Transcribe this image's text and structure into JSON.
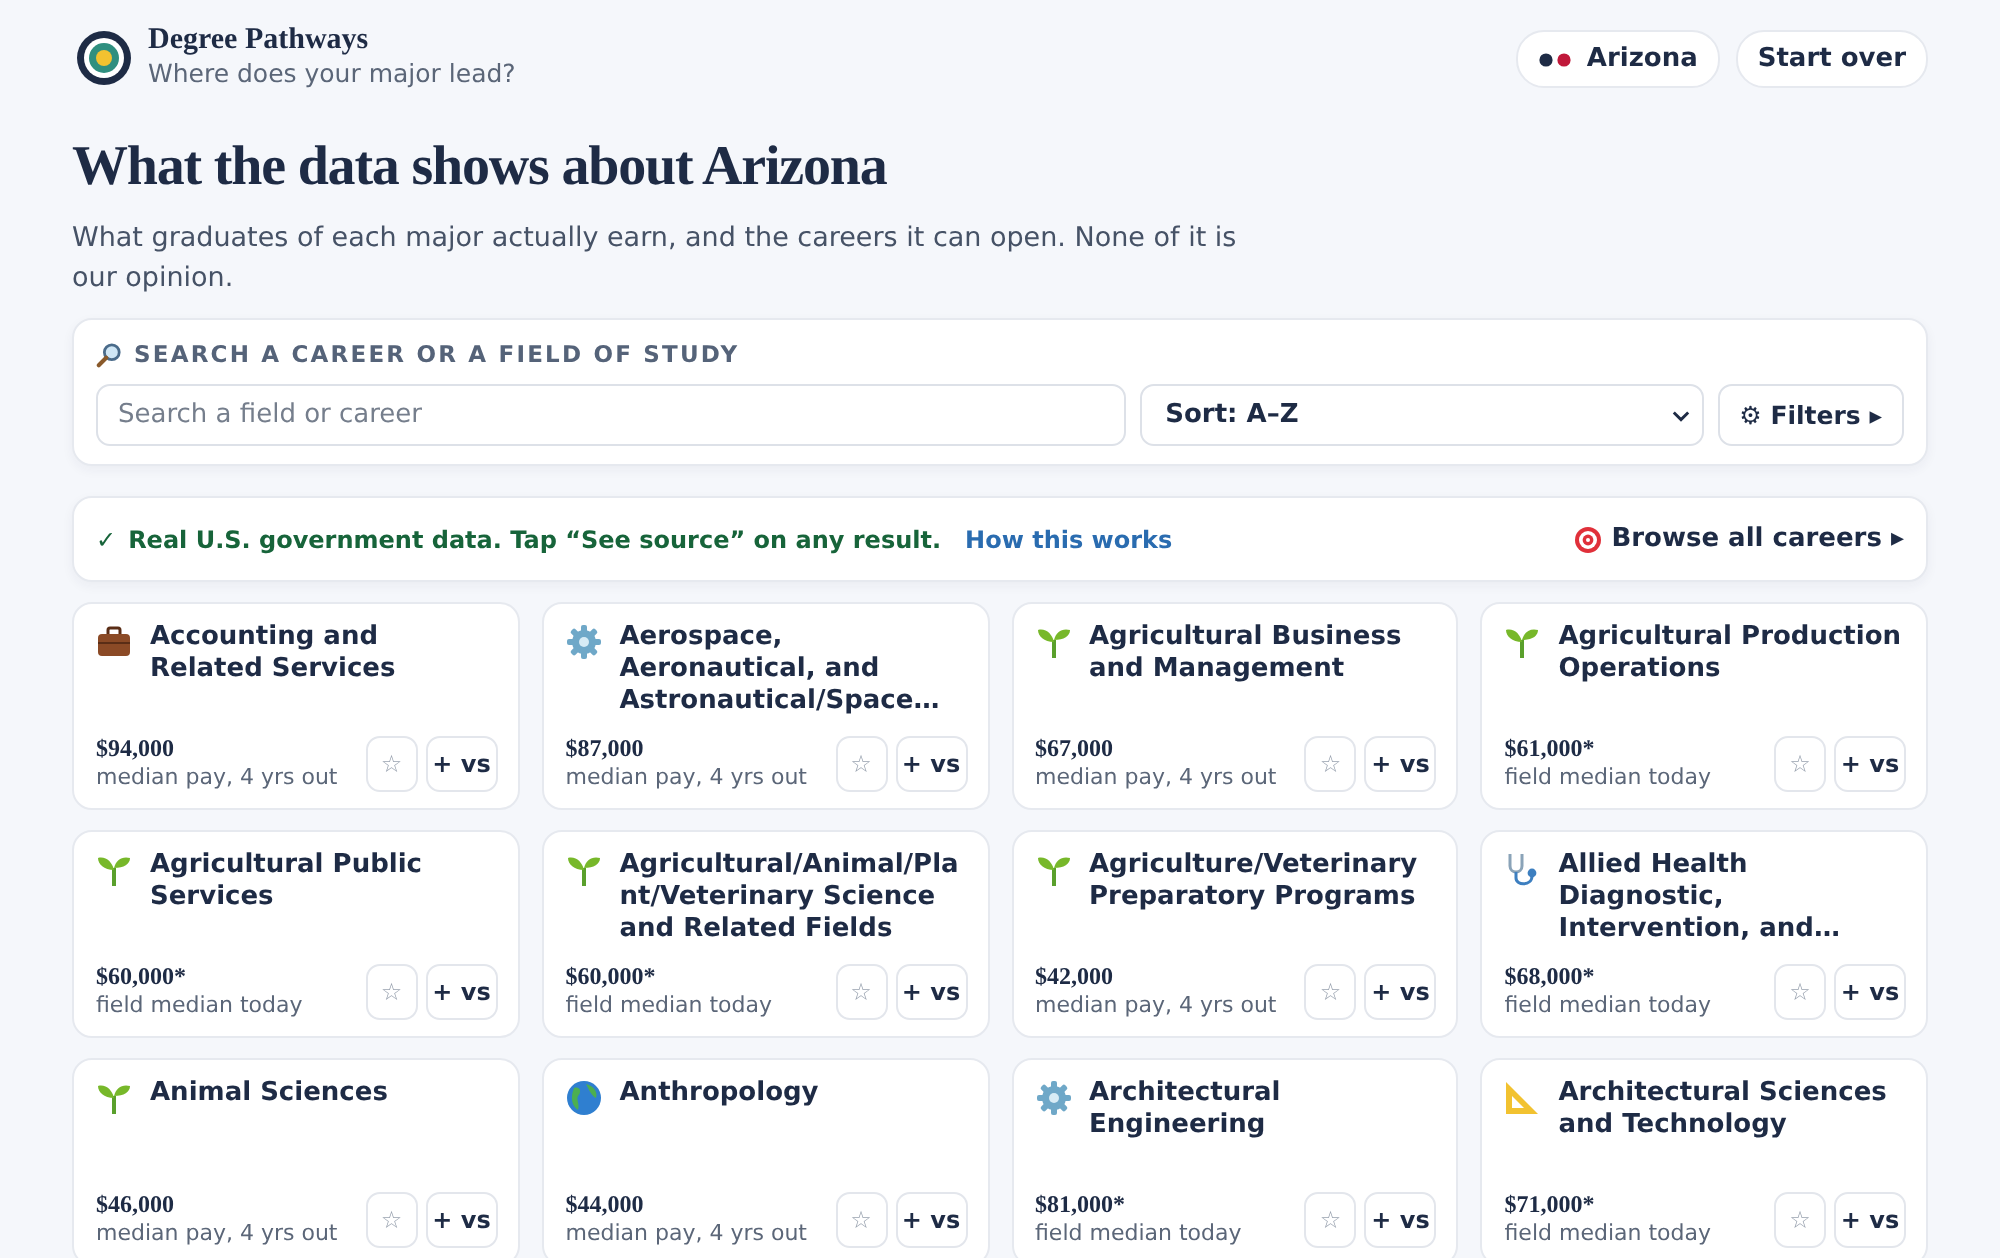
{
  "brand": {
    "name": "Degree Pathways",
    "tagline": "Where does your major lead?"
  },
  "header_actions": {
    "state": "Arizona",
    "start_over": "Start over"
  },
  "heading": "What the data shows about Arizona",
  "intro": "What graduates of each major actually earn, and the careers it can open. None of it is our opinion.",
  "search": {
    "label": "SEARCH A CAREER OR A FIELD OF STUDY",
    "placeholder": "Search a field or career",
    "sort": "Sort: A–Z",
    "filters": "⚙ Filters ▸"
  },
  "notice": {
    "check": "✓",
    "text": "Real U.S. government data. Tap “See source” on any result.",
    "link": "How this works",
    "browse": "Browse all careers ▸"
  },
  "cards": [
    {
      "kind": "briefcase",
      "title": "Accounting and Related Services",
      "pay": "$94,000",
      "note": "median pay, 4 yrs out",
      "star": "☆",
      "compare": "+ vs"
    },
    {
      "kind": "gear",
      "title": "Aerospace, Aeronautical, and Astronautical/Space…",
      "pay": "$87,000",
      "note": "median pay, 4 yrs out",
      "star": "☆",
      "compare": "+ vs"
    },
    {
      "kind": "sprout",
      "title": "Agricultural Business and Management",
      "pay": "$67,000",
      "note": "median pay, 4 yrs out",
      "star": "☆",
      "compare": "+ vs"
    },
    {
      "kind": "sprout",
      "title": "Agricultural Production Operations",
      "pay": "$61,000*",
      "note": "field median today",
      "star": "☆",
      "compare": "+ vs"
    },
    {
      "kind": "sprout",
      "title": "Agricultural Public Services",
      "pay": "$60,000*",
      "note": "field median today",
      "star": "☆",
      "compare": "+ vs"
    },
    {
      "kind": "sprout",
      "title": "Agricultural/Animal/Pla nt/Veterinary Science and Related Fields",
      "pay": "$60,000*",
      "note": "field median today",
      "star": "☆",
      "compare": "+ vs"
    },
    {
      "kind": "sprout",
      "title": "Agriculture/Veterinary Preparatory Programs",
      "pay": "$42,000",
      "note": "median pay, 4 yrs out",
      "star": "☆",
      "compare": "+ vs"
    },
    {
      "kind": "stethoscope",
      "title": "Allied Health Diagnostic, Intervention, and…",
      "pay": "$68,000*",
      "note": "field median today",
      "star": "☆",
      "compare": "+ vs"
    },
    {
      "kind": "sprout",
      "title": "Animal Sciences",
      "pay": "$46,000",
      "note": "median pay, 4 yrs out",
      "star": "☆",
      "compare": "+ vs"
    },
    {
      "kind": "globe",
      "title": "Anthropology",
      "pay": "$44,000",
      "note": "median pay, 4 yrs out",
      "star": "☆",
      "compare": "+ vs"
    },
    {
      "kind": "gear",
      "title": "Architectural Engineering",
      "pay": "$81,000*",
      "note": "field median today",
      "star": "☆",
      "compare": "+ vs"
    },
    {
      "kind": "ruler",
      "title": "Architectural Sciences and Technology",
      "pay": "$71,000*",
      "note": "field median today",
      "star": "☆",
      "compare": "+ vs"
    }
  ]
}
